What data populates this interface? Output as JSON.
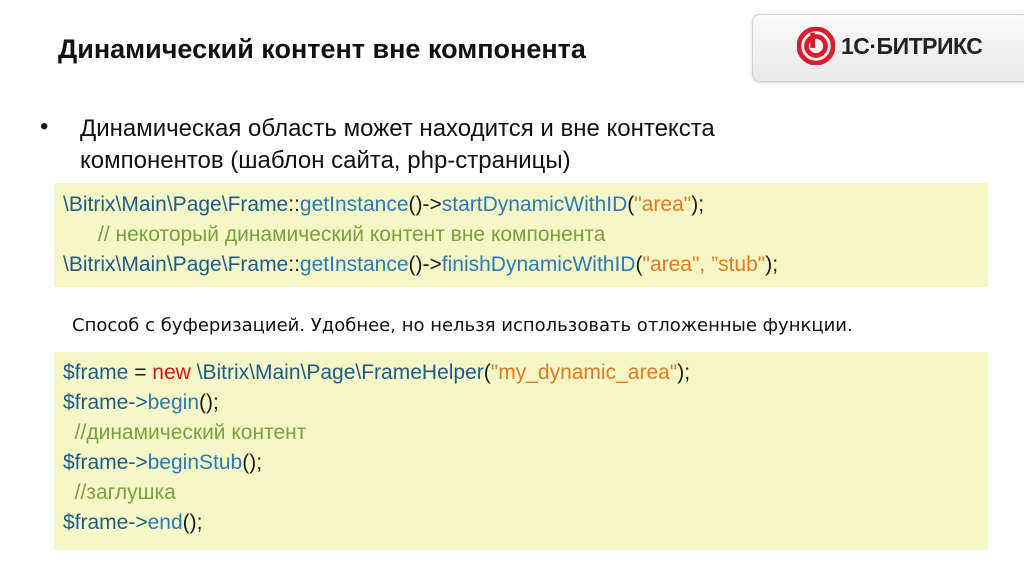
{
  "title": "Динамический контент вне компонента",
  "logo": {
    "text": "1С·БИТРИКС",
    "icon": "bitrix-logo-icon",
    "accent": "#d81e2e"
  },
  "bullet": {
    "line1": "Динамическая область может находится и вне контекста",
    "line2": "компонентов (шаблон сайта, php-страницы)"
  },
  "code1": {
    "l1_ns": "\\Bitrix\\Main\\Page\\Frame",
    "l1_sep": "::",
    "l1_fn1": "getInstance",
    "l1_mid": "()->",
    "l1_fn2": "startDynamicWithID",
    "l1_open": "(",
    "l1_str": "\"area\"",
    "l1_close": ");",
    "l2_comment": "// некоторый динамический контент вне компонента",
    "l3_ns": "\\Bitrix\\Main\\Page\\Frame",
    "l3_sep": "::",
    "l3_fn1": "getInstance",
    "l3_mid": "()->",
    "l3_fn2": "finishDynamicWithID",
    "l3_open": "(",
    "l3_str": "\"area\", ”stub\"",
    "l3_close": ");"
  },
  "note": "Способ с буферизацией. Удобнее, но нельзя использовать отложенные функции.",
  "code2": {
    "l1_var": "$frame",
    "l1_eq": " = ",
    "l1_kw": "new",
    "l1_ns": " \\Bitrix\\Main\\Page\\FrameHelper",
    "l1_open": "(",
    "l1_str": "\"my_dynamic_area\"",
    "l1_close": ");",
    "l2_var": "$frame->",
    "l2_fn": "begin",
    "l2_end": "();",
    "l3_comment": "  //динамический контент",
    "l4_var": "$frame->",
    "l4_fn": "beginStub",
    "l4_end": "();",
    "l5_comment": "  //заглушка",
    "l6_var": "$frame->",
    "l6_fn": "end",
    "l6_end": "();"
  }
}
